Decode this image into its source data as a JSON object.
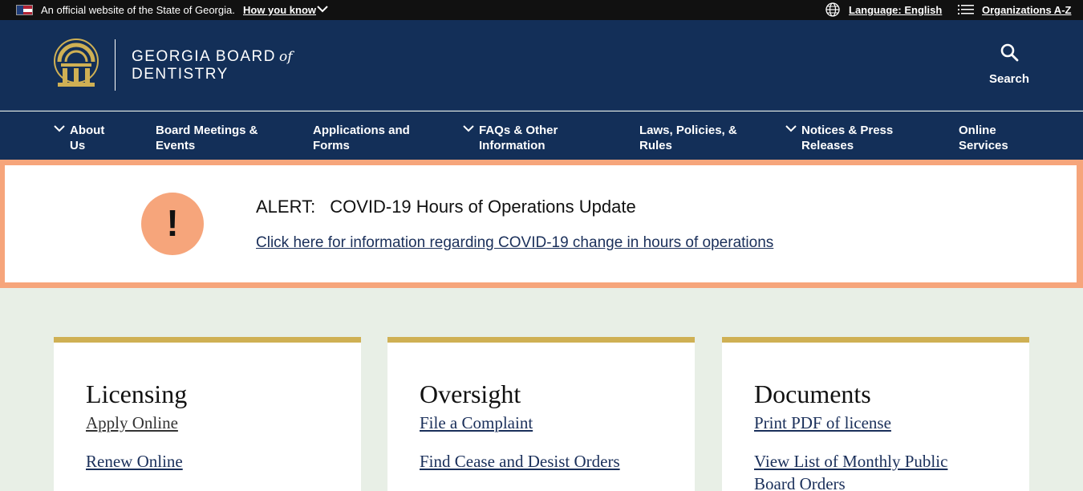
{
  "official_bar": {
    "text": "An official website of the State of Georgia.",
    "how_you_know": "How you know",
    "language": "Language: English",
    "organizations": "Organizations A-Z"
  },
  "header": {
    "brand_line1": "GEORGIA BOARD",
    "brand_of": "of",
    "brand_line2": "DENTISTRY",
    "search_label": "Search"
  },
  "nav": [
    {
      "line1": "About",
      "line2": "Us",
      "has_dropdown": true
    },
    {
      "line1": "Board Meetings &",
      "line2": "Events",
      "has_dropdown": false
    },
    {
      "line1": "Applications and",
      "line2": "Forms",
      "has_dropdown": false
    },
    {
      "line1": "FAQs & Other",
      "line2": "Information",
      "has_dropdown": true
    },
    {
      "line1": "Laws, Policies, &",
      "line2": "Rules",
      "has_dropdown": false
    },
    {
      "line1": "Notices & Press",
      "line2": "Releases",
      "has_dropdown": true
    },
    {
      "line1": "Online",
      "line2": "Services",
      "has_dropdown": false
    }
  ],
  "alert": {
    "label": "ALERT:",
    "title": "COVID-19 Hours of Operations Update",
    "link": "Click here for information regarding COVID-19 change in hours of operations",
    "icon": "!"
  },
  "cards": [
    {
      "title": "Licensing",
      "links": [
        "Apply Online",
        "Renew Online"
      ]
    },
    {
      "title": "Oversight",
      "links": [
        "File a Complaint",
        "Find Cease and Desist Orders"
      ]
    },
    {
      "title": "Documents",
      "links": [
        "Print PDF of license",
        "View List of Monthly Public",
        "Board Orders"
      ]
    }
  ],
  "colors": {
    "navy": "#132f58",
    "alert_orange": "#f6a57b",
    "gold": "#cfb054",
    "page_bg": "#e8efe6"
  }
}
